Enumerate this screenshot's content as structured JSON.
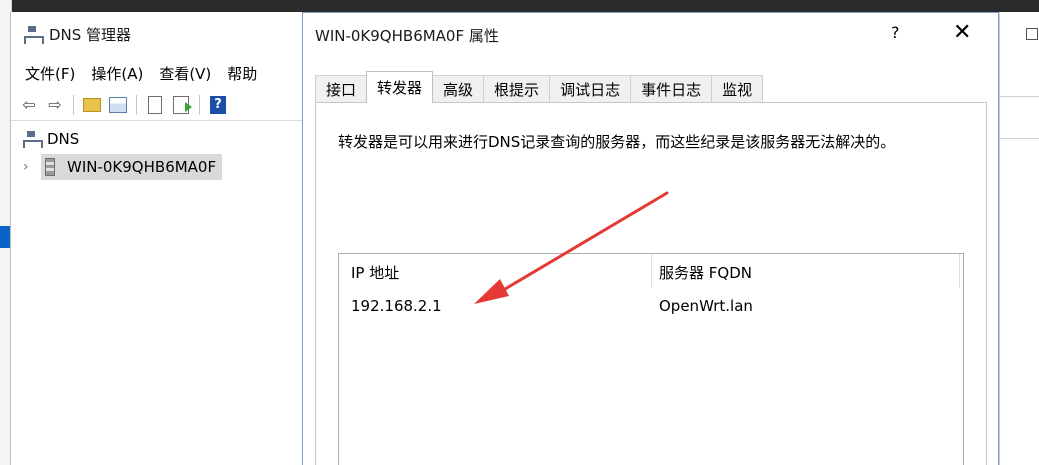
{
  "dns_manager": {
    "title": "DNS 管理器",
    "menu": [
      "文件(F)",
      "操作(A)",
      "查看(V)",
      "帮助"
    ],
    "tree": {
      "root": "DNS",
      "server": "WIN-0K9QHB6MA0F"
    }
  },
  "dialog": {
    "title": "WIN-0K9QHB6MA0F 属性",
    "help_label": "?",
    "close_label": "✕",
    "tabs": [
      "接口",
      "转发器",
      "高级",
      "根提示",
      "调试日志",
      "事件日志",
      "监视"
    ],
    "active_tab": "转发器",
    "description": "转发器是可以用来进行DNS记录查询的服务器，而这些纪录是该服务器无法解决的。",
    "columns": {
      "ip": "IP 地址",
      "fqdn": "服务器 FQDN"
    },
    "forwarders": [
      {
        "ip": "192.168.2.1",
        "fqdn": "OpenWrt.lan"
      }
    ]
  },
  "annotation": {
    "color": "#e53935"
  }
}
